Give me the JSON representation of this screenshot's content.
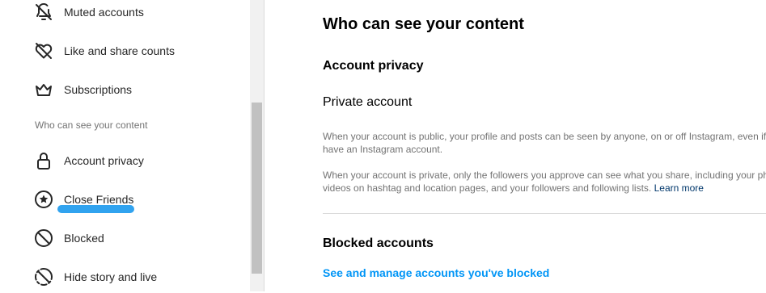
{
  "sidebar": {
    "items": [
      {
        "label": "Muted accounts",
        "icon": "muted-bell-icon"
      },
      {
        "label": "Like and share counts",
        "icon": "heart-off-icon"
      },
      {
        "label": "Subscriptions",
        "icon": "crown-icon"
      },
      {
        "label": "Account privacy",
        "icon": "lock-icon"
      },
      {
        "label": "Close Friends",
        "icon": "star-circle-icon"
      },
      {
        "label": "Blocked",
        "icon": "blocked-icon"
      },
      {
        "label": "Hide story and live",
        "icon": "hide-story-icon"
      }
    ],
    "section_heading": "Who can see your content"
  },
  "main": {
    "title": "Who can see your content",
    "account_privacy_heading": "Account privacy",
    "private_account_label": "Private account",
    "public_desc": [
      "When your account is public, your profile and posts can be seen by anyone, on or off Instagram, even if",
      "have an Instagram account."
    ],
    "private_desc": [
      "When your account is private, only the followers you approve can see what you share, including your ph",
      "videos on hashtag and location pages, and your followers and following lists."
    ],
    "learn_more": "Learn more",
    "blocked_heading": "Blocked accounts",
    "blocked_link": "See and manage accounts you've blocked"
  },
  "colors": {
    "highlight": "#31a3ef",
    "link": "#0095f6",
    "learn_more": "#00376b",
    "secondary_text": "#737373"
  }
}
